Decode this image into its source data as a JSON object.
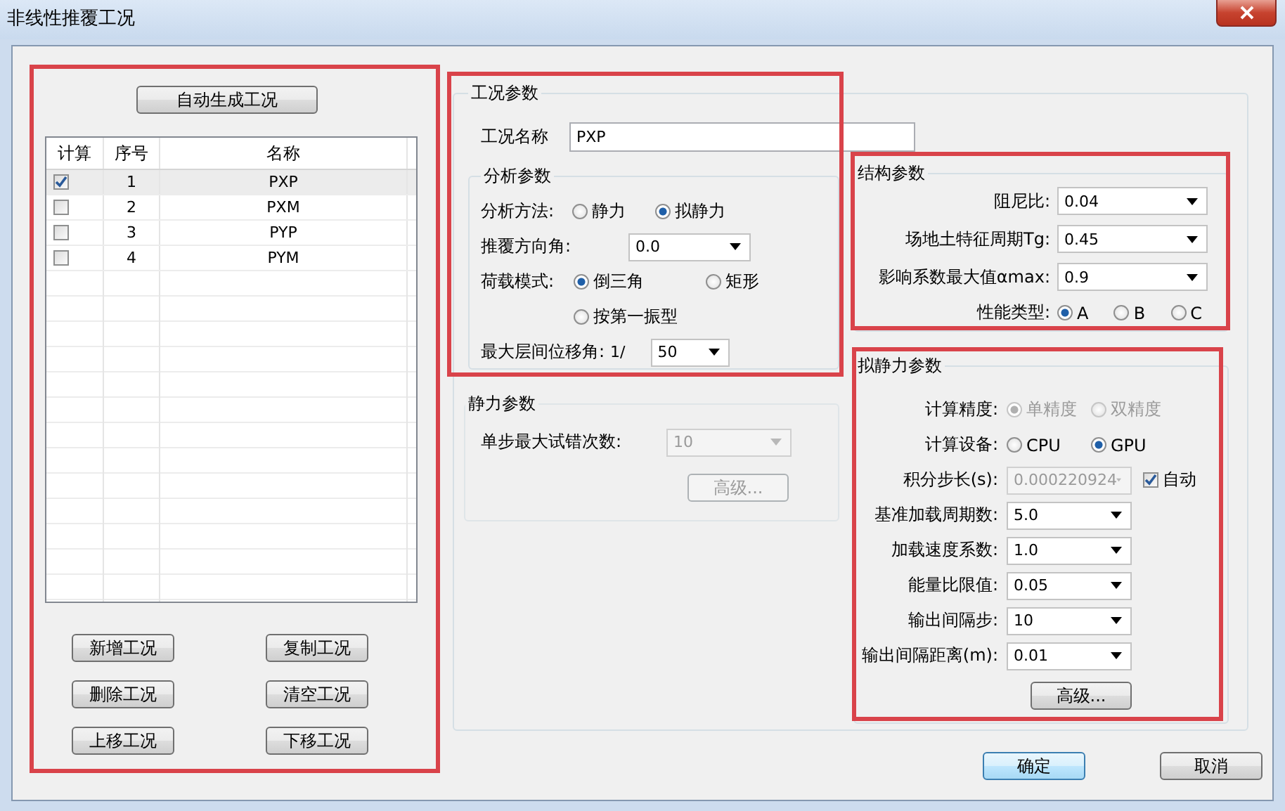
{
  "window": {
    "title": "非线性推覆工况"
  },
  "cases": {
    "auto_button": "自动生成工况",
    "table": {
      "columns": [
        "计算",
        "序号",
        "名称"
      ],
      "rows": [
        {
          "checked": true,
          "selected": true,
          "index": "1",
          "name": "PXP"
        },
        {
          "checked": false,
          "selected": false,
          "index": "2",
          "name": "PXM"
        },
        {
          "checked": false,
          "selected": false,
          "index": "3",
          "name": "PYP"
        },
        {
          "checked": false,
          "selected": false,
          "index": "4",
          "name": "PYM"
        }
      ]
    },
    "buttons": [
      "新增工况",
      "复制工况",
      "删除工况",
      "清空工况",
      "上移工况",
      "下移工况"
    ]
  },
  "case_params": {
    "title": "工况参数",
    "name_label": "工况名称",
    "name_value": "PXP",
    "analysis": {
      "title": "分析参数",
      "method": {
        "label": "分析方法:",
        "options": [
          {
            "label": "静力",
            "selected": false
          },
          {
            "label": "拟静力",
            "selected": true
          }
        ]
      },
      "direction": {
        "label": "推覆方向角:",
        "value": "0.0"
      },
      "load_mode": {
        "label": "荷载模式:",
        "options": [
          {
            "label": "倒三角",
            "selected": true
          },
          {
            "label": "矩形",
            "selected": false
          },
          {
            "label": "按第一振型",
            "selected": false
          }
        ]
      },
      "drift": {
        "label": "最大层间位移角:",
        "prefix": "1/",
        "value": "50"
      }
    },
    "static": {
      "title": "静力参数",
      "disabled": true,
      "trials_label": "单步最大试错次数:",
      "trials_value": "10",
      "advanced": "高级..."
    },
    "structure": {
      "title": "结构参数",
      "fields": [
        {
          "label": "阻尼比:",
          "value": "0.04"
        },
        {
          "label": "场地土特征周期Tg:",
          "value": "0.45"
        },
        {
          "label": "影响系数最大值αmax:",
          "value": "0.9"
        }
      ],
      "performance": {
        "label": "性能类型:",
        "options": [
          {
            "label": "A",
            "selected": true
          },
          {
            "label": "B",
            "selected": false
          },
          {
            "label": "C",
            "selected": false
          }
        ]
      }
    },
    "quasi_static": {
      "title": "拟静力参数",
      "precision": {
        "label": "计算精度:",
        "disabled": true,
        "options": [
          {
            "label": "单精度",
            "selected": true
          },
          {
            "label": "双精度",
            "selected": false
          }
        ]
      },
      "device": {
        "label": "计算设备:",
        "disabled": false,
        "options": [
          {
            "label": "CPU",
            "selected": false
          },
          {
            "label": "GPU",
            "selected": true
          }
        ]
      },
      "step": {
        "label": "积分步长(s):",
        "value": "0.000220924",
        "disabled": true,
        "auto_label": "自动",
        "auto_checked": true
      },
      "fields": [
        {
          "label": "基准加载周期数:",
          "value": "5.0"
        },
        {
          "label": "加载速度系数:",
          "value": "1.0"
        },
        {
          "label": "能量比限值:",
          "value": "0.05"
        },
        {
          "label": "输出间隔步:",
          "value": "10"
        },
        {
          "label": "输出间隔距离(m):",
          "value": "0.01"
        }
      ],
      "advanced": "高级..."
    }
  },
  "buttons": [
    {
      "label": "确定",
      "default": true
    },
    {
      "label": "取消",
      "default": false
    }
  ]
}
